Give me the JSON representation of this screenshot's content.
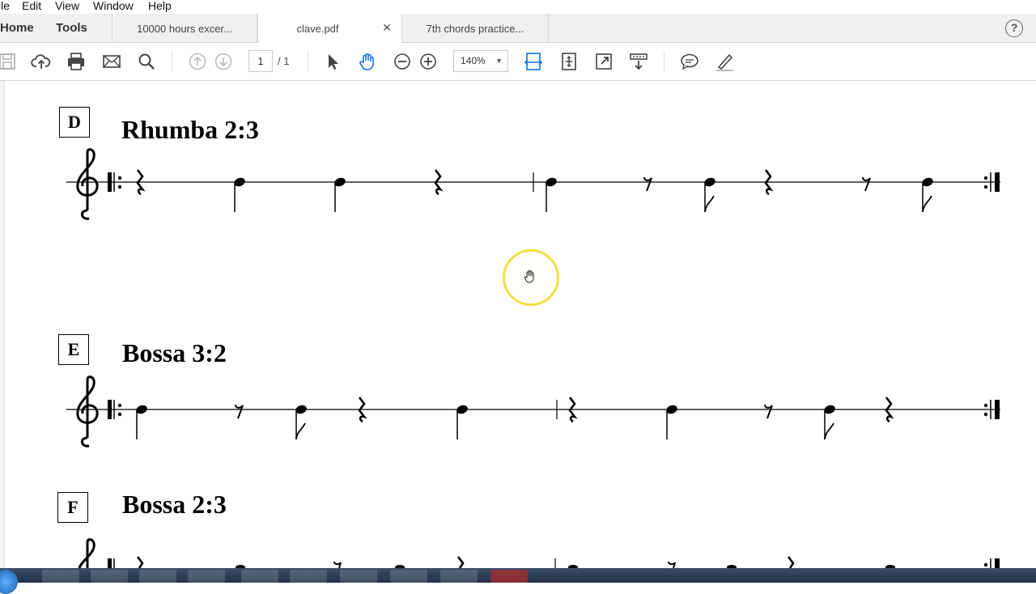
{
  "menu": [
    "ile",
    "Edit",
    "View",
    "Window",
    "Help"
  ],
  "nav": {
    "home": "Home",
    "tools": "Tools"
  },
  "tabs": [
    {
      "label": "10000 hours excer..."
    },
    {
      "label": "clave.pdf",
      "close": "✕"
    },
    {
      "label": "7th chords practice..."
    }
  ],
  "help": "?",
  "toolbar": {
    "page_current": "1",
    "page_total": "/ 1",
    "zoom": "140%",
    "zoom_caret": "▼"
  },
  "sections": [
    {
      "label": "D",
      "title": "Rhumba 2:3"
    },
    {
      "label": "E",
      "title": "Bossa 3:2"
    },
    {
      "label": "F",
      "title": "Bossa 2:3"
    }
  ],
  "colors": {
    "accent": "#1473e6",
    "cursor_ring": "#f0e040"
  },
  "cursor": {
    "icon": "hand-cursor-icon"
  }
}
